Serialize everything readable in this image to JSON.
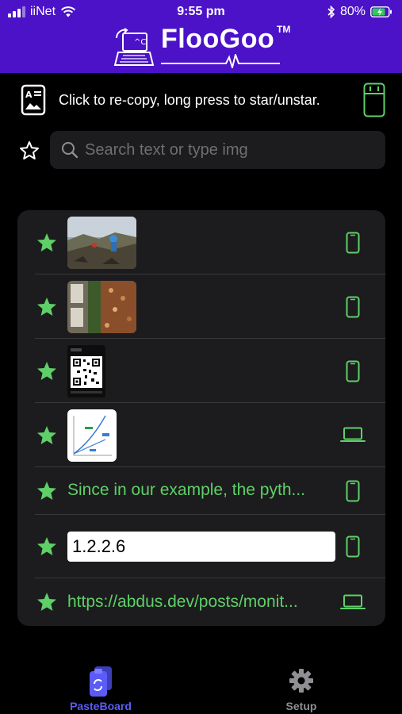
{
  "status_bar": {
    "carrier": "iiNet",
    "time": "9:55 pm",
    "battery": "80%"
  },
  "brand": {
    "name": "FlooGoo",
    "trademark": "TM"
  },
  "hint": {
    "text": "Click to re-copy, long press to star/unstar."
  },
  "search": {
    "placeholder": "Search text or type img",
    "value": ""
  },
  "clips": [
    {
      "kind": "image",
      "image": "landscape-photo",
      "starred": true,
      "device": "phone"
    },
    {
      "kind": "image",
      "image": "document-photos",
      "starred": true,
      "device": "phone"
    },
    {
      "kind": "image",
      "image": "qr-code",
      "starred": true,
      "device": "phone"
    },
    {
      "kind": "image",
      "image": "line-chart",
      "starred": true,
      "device": "laptop"
    },
    {
      "kind": "text",
      "text": "Since in our example, the pyth...",
      "starred": true,
      "device": "phone"
    },
    {
      "kind": "box",
      "text": "1.2.2.6",
      "starred": true,
      "device": "phone"
    },
    {
      "kind": "text",
      "text": "https://abdus.dev/posts/monit...",
      "starred": true,
      "device": "laptop"
    }
  ],
  "tabs": [
    {
      "label": "PasteBoard",
      "active": true
    },
    {
      "label": "Setup",
      "active": false
    }
  ],
  "colors": {
    "header": "#4b12c7",
    "accent_green": "#5fd068",
    "active_tab": "#5b5cf5",
    "inactive_tab": "#8e8e93"
  }
}
